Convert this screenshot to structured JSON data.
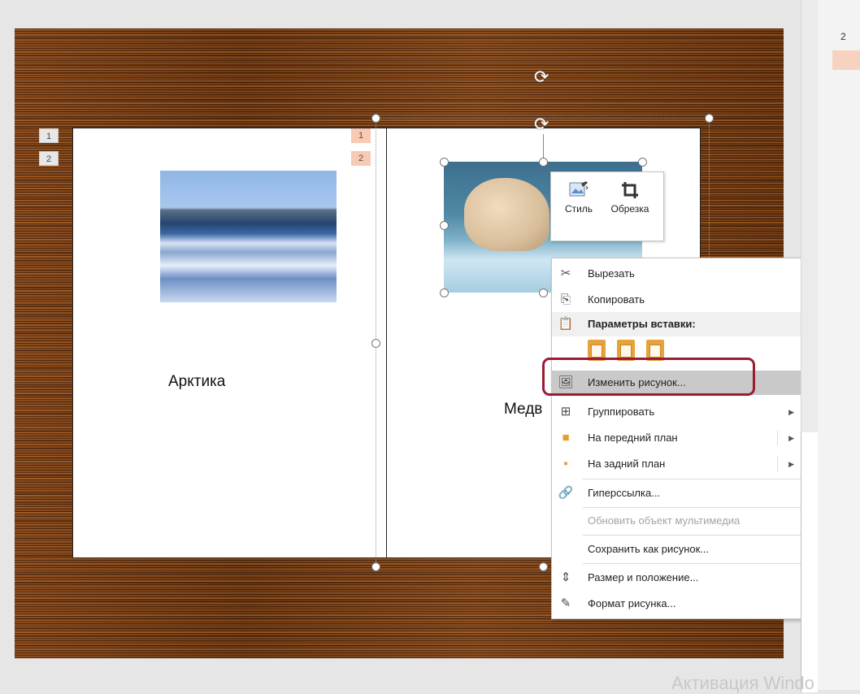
{
  "slide": {
    "left_page": {
      "numbers": [
        "1",
        "2"
      ],
      "label": "Арктика"
    },
    "right_page": {
      "numbers": [
        "1",
        "2"
      ],
      "label": "Медв"
    }
  },
  "mini_toolbar": {
    "style_label": "Стиль",
    "crop_label": "Обрезка"
  },
  "context_menu": {
    "items": [
      {
        "label": "Вырезать",
        "icon": "scissors-icon"
      },
      {
        "label": "Копировать",
        "icon": "copy-icon"
      },
      {
        "label": "Параметры вставки:",
        "icon": "paste-icon"
      },
      {
        "label": "Изменить рисунок...",
        "icon": "change-picture-icon"
      },
      {
        "label": "Группировать",
        "icon": "group-icon",
        "submenu": true
      },
      {
        "label": "На передний план",
        "icon": "bring-front-icon",
        "submenu": true
      },
      {
        "label": "На задний план",
        "icon": "send-back-icon",
        "submenu": true
      },
      {
        "label": "Гиперссылка...",
        "icon": "hyperlink-icon"
      },
      {
        "label": "Обновить объект мультимедиа",
        "icon": "",
        "disabled": true
      },
      {
        "label": "Сохранить как рисунок...",
        "icon": ""
      },
      {
        "label": "Размер и положение...",
        "icon": "size-position-icon"
      },
      {
        "label": "Формат рисунка...",
        "icon": "format-picture-icon"
      }
    ],
    "highlight_color": "#9b1b30"
  },
  "thumbnail_panel": {
    "slide_number": "2"
  },
  "watermark": "Активация Windo"
}
